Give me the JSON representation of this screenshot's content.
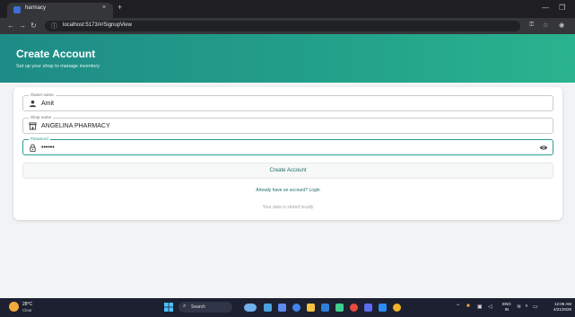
{
  "browser": {
    "tab_title": "harmacy",
    "tab_close_glyph": "×",
    "new_tab_glyph": "+",
    "url": "localhost:5173/#/SignupView",
    "colors": {
      "tabstrip": "#1f1f23",
      "toolbar": "#35363a"
    }
  },
  "header": {
    "title": "Create Account",
    "subtitle": "Set up your shop to manage inventory",
    "accent": "#23a28a"
  },
  "form": {
    "owner": {
      "label": "Owner name",
      "value": "Amit",
      "icon": "person-icon"
    },
    "shop": {
      "label": "Shop name",
      "value": "ANGELINA PHARMACY",
      "icon": "store-icon"
    },
    "password": {
      "label": "Password",
      "value": "••••••",
      "icon": "lock-icon",
      "toggle_icon": "eye-icon"
    },
    "submit_label": "Create Account",
    "login_link": "Already have an account? Login",
    "note": "Your data is stored locally"
  },
  "taskbar": {
    "weather_temp": "28°C",
    "weather_desc": "Clear",
    "search_label": "Search",
    "lang_top": "ENG",
    "lang_bottom": "IN",
    "time": "12:09 AM",
    "date": "4/21/2026"
  }
}
